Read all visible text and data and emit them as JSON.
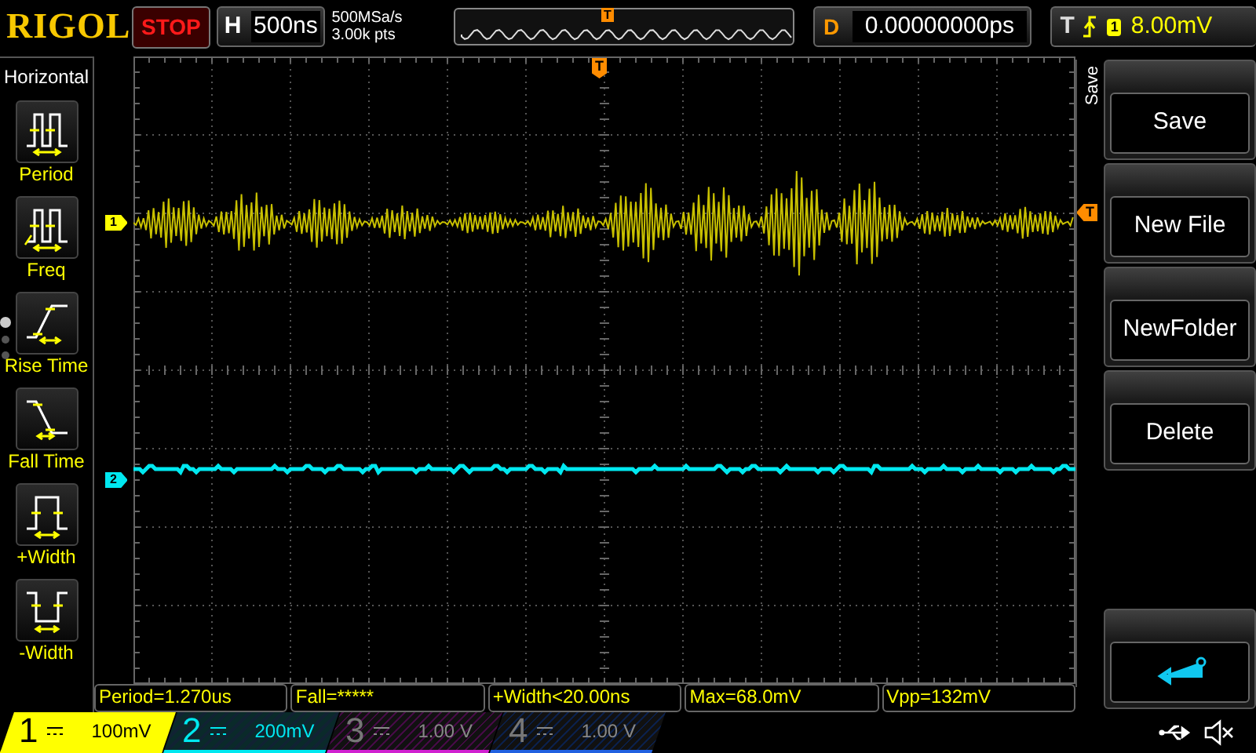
{
  "logo": "RIGOL",
  "run_state": "STOP",
  "horizontal": {
    "label": "H",
    "timebase": "500ns"
  },
  "acquisition": {
    "sample_rate": "500MSa/s",
    "depth": "3.00k pts"
  },
  "overview": {
    "marker": "T"
  },
  "delay": {
    "label": "D",
    "value": "0.00000000ps"
  },
  "trigger": {
    "label": "T",
    "source": "1",
    "level": "8.00mV"
  },
  "left_menu": {
    "title": "Horizontal",
    "items": [
      {
        "label": "Period",
        "kind": "period"
      },
      {
        "label": "Freq",
        "kind": "freq"
      },
      {
        "label": "Rise Time",
        "kind": "rise"
      },
      {
        "label": "Fall Time",
        "kind": "fall"
      },
      {
        "label": "+Width",
        "kind": "pwidth"
      },
      {
        "label": "-Width",
        "kind": "nwidth"
      }
    ],
    "pages": [
      {
        "selected": true
      },
      {
        "selected": false
      },
      {
        "selected": false
      }
    ]
  },
  "screen": {
    "trigger_position_marker": "T",
    "trigger_level_marker": "T",
    "channel_markers": [
      {
        "label": "1",
        "color": "#ffff00"
      },
      {
        "label": "2",
        "color": "#00e8f0"
      }
    ]
  },
  "save_menu": {
    "title": "Save",
    "buttons": [
      {
        "label": "Save"
      },
      {
        "label": "New File"
      },
      {
        "label": "NewFolder"
      },
      {
        "label": "Delete"
      }
    ]
  },
  "measurements": [
    "Period=1.270us",
    "Fall=*****",
    "+Width<20.00ns",
    "Max=68.0mV",
    "Vpp=132mV"
  ],
  "channels": [
    {
      "number": "1",
      "scale": "100mV",
      "enabled": true,
      "selected": true,
      "color": "#ffff00"
    },
    {
      "number": "2",
      "scale": "200mV",
      "enabled": true,
      "selected": false,
      "color": "#00e8f0"
    },
    {
      "number": "3",
      "scale": "1.00 V",
      "enabled": false,
      "selected": false,
      "color": "#d020d0"
    },
    {
      "number": "4",
      "scale": "1.00 V",
      "enabled": false,
      "selected": false,
      "color": "#2060e0"
    }
  ]
}
